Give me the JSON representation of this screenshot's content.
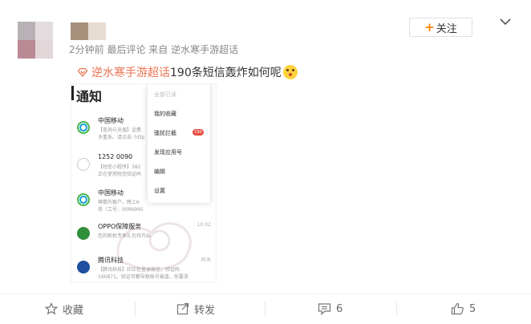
{
  "post": {
    "meta": "2分钟前 最后评论 来自 逆水寒手游超话",
    "follow_label": "关注",
    "topic": "逆水寒手游超话",
    "body": "190条短信轰炸如何呢"
  },
  "screenshot": {
    "title": "通知",
    "menu": [
      {
        "label": "全部已读",
        "dim": true
      },
      {
        "label": "我的收藏"
      },
      {
        "label": "骚扰拦截",
        "badge": "190"
      },
      {
        "label": "发现应用号"
      },
      {
        "label": "编辑"
      },
      {
        "label": "设置"
      }
    ],
    "messages": [
      {
        "name": "中国移动",
        "line1": "【查询与充值】话费",
        "line2": "多重系、请点击: http",
        "time": "",
        "icon": "china-mobile"
      },
      {
        "name": "1252 0090",
        "line1": "【短信小程序】382",
        "line2": "正在使用短信验证码",
        "time": "",
        "icon": "number"
      },
      {
        "name": "中国移动",
        "line1": "尊敬的客户，晚上6",
        "line2": "务（工号：0096995",
        "time": "",
        "icon": "china-mobile"
      },
      {
        "name": "OPPO保障服务",
        "line1": "您的新机专享礼包待开启",
        "line2": "",
        "time": "10:02",
        "icon": "oppo"
      },
      {
        "name": "腾讯科技",
        "line1": "【腾讯科技】印正在登录微信，验证码",
        "line2": "160871。验证可都导致账号被盗，你要求",
        "time": "昨天",
        "icon": "tencent"
      }
    ]
  },
  "toolbar": {
    "favorite_label": "收藏",
    "repost_label": "转发",
    "comment_count": "6",
    "like_count": "5"
  },
  "colors": {
    "accent": "#ff8200",
    "topic": "#eb7350"
  }
}
